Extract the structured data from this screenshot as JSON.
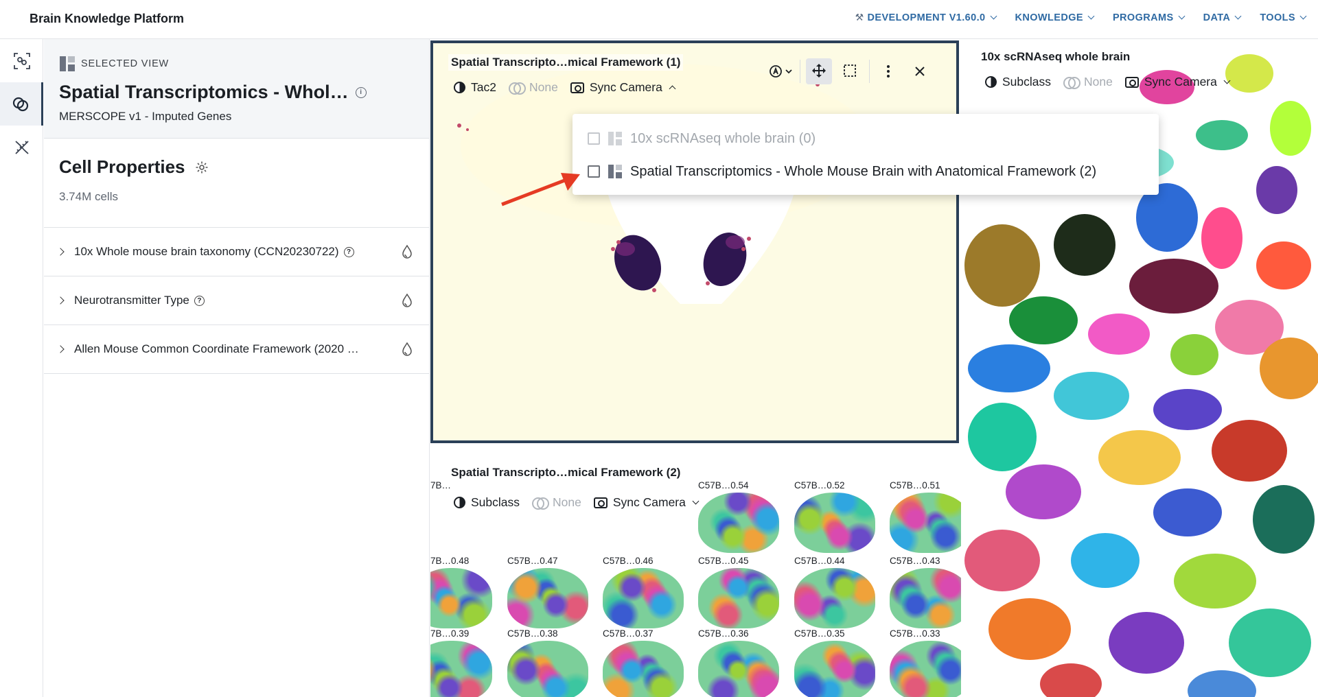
{
  "header": {
    "brand": "Brain Knowledge Platform",
    "nav": [
      {
        "label": "DEVELOPMENT V1.60.0",
        "icon": "tools-icon"
      },
      {
        "label": "KNOWLEDGE"
      },
      {
        "label": "PROGRAMS"
      },
      {
        "label": "DATA"
      },
      {
        "label": "TOOLS"
      }
    ]
  },
  "rail": [
    "cells-icon",
    "overlap-icon",
    "dna-icon"
  ],
  "selected_view": {
    "label": "SELECTED VIEW",
    "title": "Spatial Transcriptomics - Whol…",
    "subtitle": "MERSCOPE v1 - Imputed Genes"
  },
  "cell_properties": {
    "title": "Cell Properties",
    "count": "3.74M cells",
    "items": [
      {
        "label": "10x Whole mouse brain taxonomy (CCN20230722)",
        "help": true
      },
      {
        "label": "Neurotransmitter Type",
        "help": true
      },
      {
        "label": "Allen Mouse Common Coordinate Framework (2020 …",
        "help": false
      }
    ]
  },
  "viewer1": {
    "title": "Spatial Transcripto…mical Framework (1)",
    "color_by": "Tac2",
    "filter": "None",
    "sync": "Sync Camera"
  },
  "viewer2": {
    "title": "Spatial Transcripto…mical Framework (2)",
    "color_by": "Subclass",
    "filter": "None",
    "sync": "Sync Camera",
    "thumbs": [
      [
        "7B…",
        "",
        "",
        "C57B…0.54",
        "C57B…0.52",
        "C57B…0.51"
      ],
      [
        "7B…0.48",
        "C57B…0.47",
        "C57B…0.46",
        "C57B…0.45",
        "C57B…0.44",
        "C57B…0.43"
      ],
      [
        "7B…0.39",
        "C57B…0.38",
        "C57B…0.37",
        "C57B…0.36",
        "C57B…0.35",
        "C57B…0.33"
      ]
    ]
  },
  "viewer3": {
    "title": "10x scRNAseq whole brain",
    "color_by": "Subclass",
    "filter": "None",
    "sync": "Sync Camera"
  },
  "sync_dropdown": {
    "items": [
      {
        "label": "10x scRNAseq whole brain (0)",
        "disabled": true
      },
      {
        "label": "Spatial Transcriptomics - Whole Mouse Brain with Anatomical Framework (2)",
        "disabled": false
      }
    ]
  },
  "colors": {
    "accent": "#2f6aa3",
    "frame": "#2b4058",
    "arrow": "#e53b24"
  }
}
